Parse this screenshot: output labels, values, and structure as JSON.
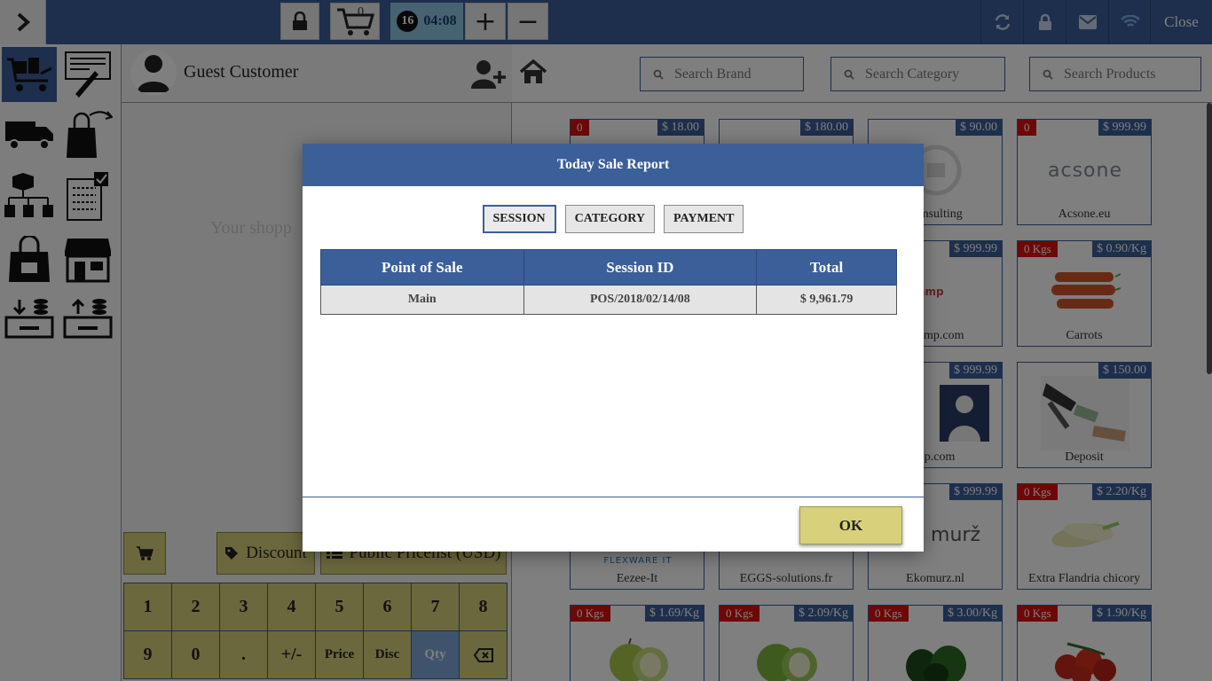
{
  "topbar": {
    "cart_count": "0",
    "session_number": "16",
    "session_time": "04:08",
    "plus_label": "+",
    "minus_label": "−",
    "close_label": "Close"
  },
  "customer": {
    "name": "Guest Customer"
  },
  "order": {
    "empty_text": "Your shopp",
    "discount_label": "Discount",
    "pricelist_label": "Public Pricelist (USD)"
  },
  "numpad": {
    "keys": [
      "1",
      "2",
      "3",
      "4",
      "5",
      "6",
      "7",
      "8",
      "9",
      "0",
      ".",
      "+/-",
      "Price",
      "Disc",
      "Qty"
    ]
  },
  "search": {
    "brand_placeholder": "Search Brand",
    "category_placeholder": "Search Category",
    "products_placeholder": "Search Products"
  },
  "products": [
    {
      "name": "",
      "price": "$ 18.00",
      "stock": "0"
    },
    {
      "name": "",
      "price": "$ 180.00",
      "stock": ""
    },
    {
      "name": "Consulting",
      "price": "$ 90.00",
      "stock": ""
    },
    {
      "name": "Acsone.eu",
      "price": "$ 999.99",
      "stock": "0",
      "logo": "acsone"
    },
    {
      "name": "ocamp.com",
      "price": "$ 999.99",
      "stock": "",
      "logo": "ocamp"
    },
    {
      "name": "Carrots",
      "price": "$ 0.90/Kg",
      "stock": "0 Kgs"
    },
    {
      "name": "alp.com",
      "price": "$ 999.99",
      "stock": ""
    },
    {
      "name": "Deposit",
      "price": "$ 150.00",
      "stock": ""
    },
    {
      "name": "Eezee-It",
      "price": "",
      "stock": "",
      "logo": "FLEXWARE IT"
    },
    {
      "name": "EGGS-solutions.fr",
      "price": "",
      "stock": ""
    },
    {
      "name": "Ekomurz.nl",
      "price": "$ 999.99",
      "stock": "",
      "logo": "murž"
    },
    {
      "name": "Extra Flandria chicory",
      "price": "$ 2.20/Kg",
      "stock": "0 Kgs"
    },
    {
      "name": "",
      "price": "$ 1.69/Kg",
      "stock": "0 Kgs"
    },
    {
      "name": "",
      "price": "$ 2.09/Kg",
      "stock": "0 Kgs"
    },
    {
      "name": "",
      "price": "$ 3.00/Kg",
      "stock": "0 Kgs"
    },
    {
      "name": "",
      "price": "$ 1.90/Kg",
      "stock": "0 Kgs"
    }
  ],
  "modal": {
    "title": "Today Sale Report",
    "tabs": [
      "SESSION",
      "CATEGORY",
      "PAYMENT"
    ],
    "active_tab": "SESSION",
    "columns": [
      "Point of Sale",
      "Session ID",
      "Total"
    ],
    "rows": [
      {
        "pos": "Main",
        "session_id": "POS/2018/02/14/08",
        "total": "$ 9,961.79"
      }
    ],
    "ok_label": "OK"
  },
  "colors": {
    "primary": "#3b5f99",
    "button_yellow": "#d8d07a",
    "stock_red": "#dd1111",
    "session_blue": "#8fc5e3"
  }
}
